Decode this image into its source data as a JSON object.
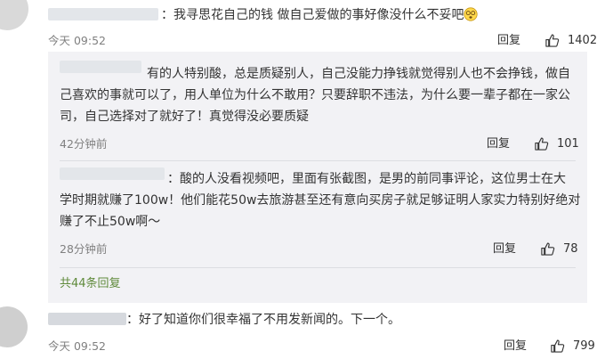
{
  "comment_main": {
    "text": "：我寻思花自己的钱 做自己爱做的事好像没什么不妥吧",
    "emoji_icon": "dizzy-face-emoji",
    "time": "今天 09:52",
    "reply_label": "回复",
    "likes": "1402"
  },
  "replies": [
    {
      "lines": [
        "有的人特别酸，总是质疑别人，自己没能力挣钱就觉得别人也不会挣钱，做自",
        "己喜欢的事就可以了，用人单位为什么不敢用？只要辞职不违法，为什么要一辈子都在一家公",
        "司，自己选择对了就好了！真觉得没必要质疑"
      ],
      "time": "42分钟前",
      "reply_label": "回复",
      "likes": "101"
    },
    {
      "lines": [
        "：酸的人没看视频吧，里面有张截图，是男的前同事评论，这位男士在大",
        "学时期就赚了100w！他们能花50w去旅游甚至还有意向买房子就足够证明人家实力特别好绝对",
        "赚了不止50w啊～"
      ],
      "time": "28分钟前",
      "reply_label": "回复",
      "likes": "78"
    }
  ],
  "more_replies_label": "共44条回复",
  "comment_second": {
    "text": "：好了知道你们很幸福了不用发新闻的。下一个。",
    "time": "今天 09:52",
    "reply_label": "回复",
    "likes": "799"
  },
  "colors": {
    "reply_background": "#f2f2f5",
    "link_green": "#5f8a3b",
    "meta_gray": "#808080"
  }
}
